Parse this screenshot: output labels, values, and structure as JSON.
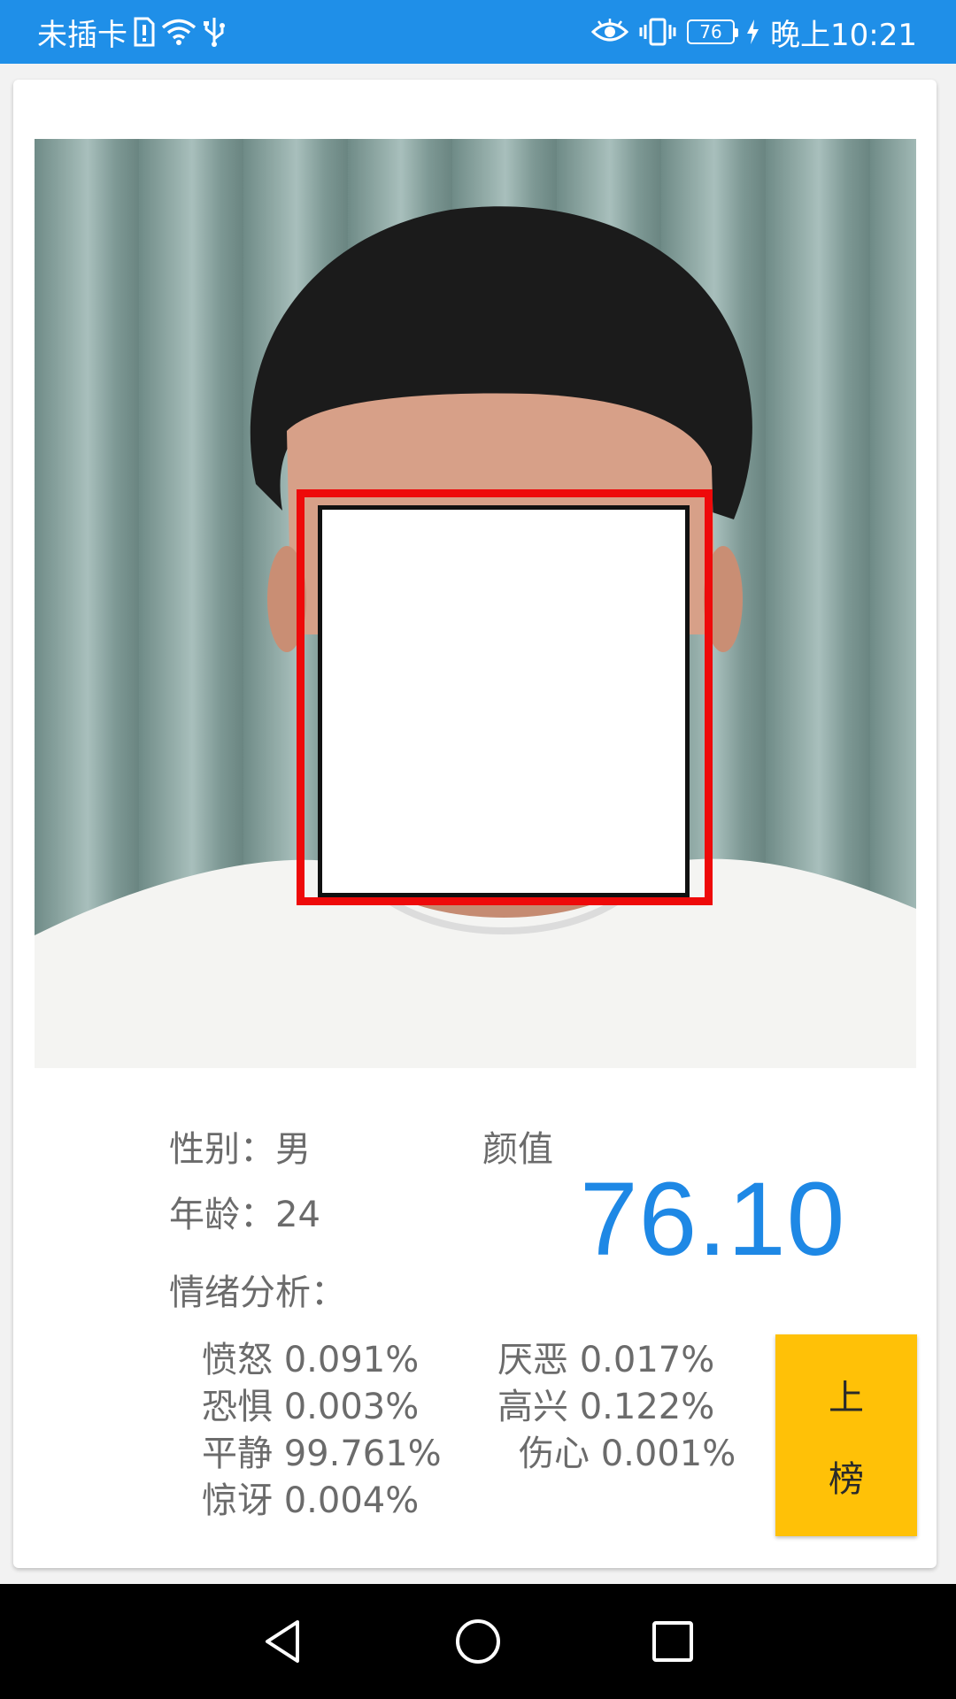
{
  "status_bar": {
    "carrier": "未插卡",
    "battery": "76",
    "time": "晚上10:21",
    "color": "#1f8fe8"
  },
  "photo": {
    "face_box_color": "#ee0a0a"
  },
  "info": {
    "gender_label": "性别：男",
    "age_label": "年龄：24",
    "emotion_title": "情绪分析：",
    "score_label": "颜值",
    "score_value": "76.10",
    "score_color": "#1e88e5"
  },
  "emotions": [
    {
      "label": "愤怒 0.091%"
    },
    {
      "label": "厌恶 0.017%"
    },
    {
      "label": "恐惧 0.003%"
    },
    {
      "label": "高兴 0.122%"
    },
    {
      "label": "平静 99.761%"
    },
    {
      "label": "伤心 0.001%"
    },
    {
      "label": "惊讶 0.004%"
    }
  ],
  "rank_button": {
    "line1": "上",
    "line2": "榜",
    "color": "#ffc107"
  },
  "nav": {
    "back_icon": "back-triangle-icon",
    "home_icon": "home-circle-icon",
    "recents_icon": "recents-square-icon"
  }
}
